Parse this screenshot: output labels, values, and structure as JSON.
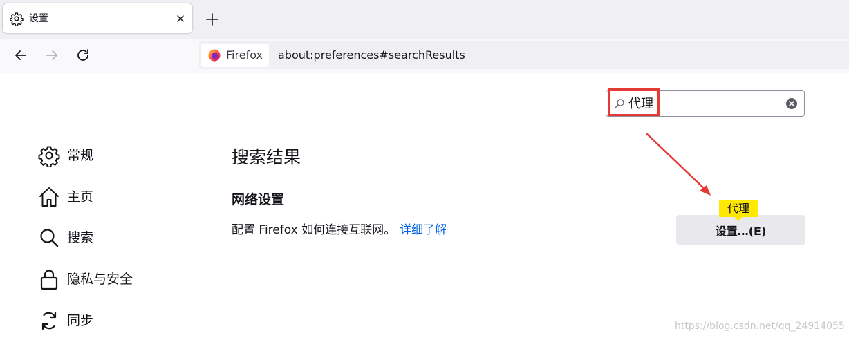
{
  "tab": {
    "title": "设置",
    "icon": "gear-icon"
  },
  "toolbar": {
    "identity_label": "Firefox",
    "url": "about:preferences#searchResults"
  },
  "search": {
    "value": "代理",
    "placeholder": ""
  },
  "sidebar": {
    "items": [
      {
        "label": "常规",
        "icon": "gear-icon"
      },
      {
        "label": "主页",
        "icon": "home-icon"
      },
      {
        "label": "搜索",
        "icon": "search-icon"
      },
      {
        "label": "隐私与安全",
        "icon": "lock-icon"
      },
      {
        "label": "同步",
        "icon": "sync-icon"
      }
    ]
  },
  "main": {
    "results_title": "搜索结果",
    "group_title": "网络设置",
    "group_desc": "配置 Firefox 如何连接互联网。",
    "learn_more": "详细了解",
    "settings_button": "设置…(E)",
    "tooltip": "代理"
  },
  "watermark": "https://blog.csdn.net/qq_24914055",
  "colors": {
    "accent": "#0060df",
    "highlight": "#ffe900",
    "annotation": "#e53935"
  }
}
